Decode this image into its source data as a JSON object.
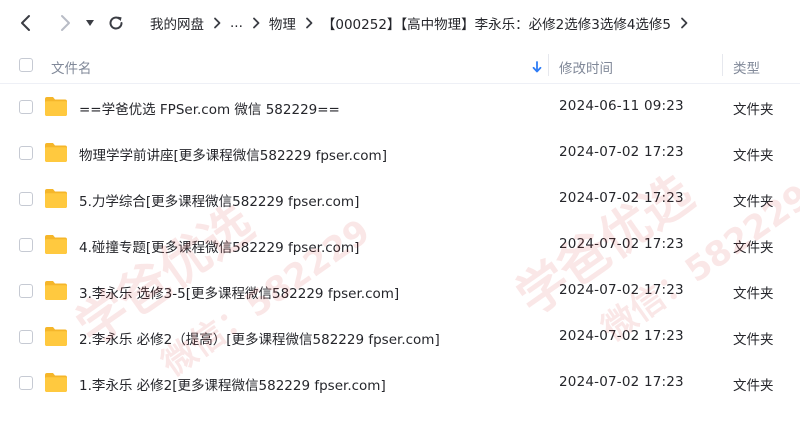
{
  "breadcrumb": {
    "items": [
      "我的网盘",
      "...",
      "物理",
      "【000252】【高中物理】李永乐：必修2选修3选修4选修5"
    ]
  },
  "header": {
    "name_label": "文件名",
    "time_label": "修改时间",
    "type_label": "类型"
  },
  "files": [
    {
      "name": "==学爸优选 FPSer.com 微信 582229==",
      "modified": "2024-06-11 09:23",
      "type": "文件夹"
    },
    {
      "name": "物理学学前讲座[更多课程微信582229 fpser.com]",
      "modified": "2024-07-02 17:23",
      "type": "文件夹"
    },
    {
      "name": "5.力学综合[更多课程微信582229 fpser.com]",
      "modified": "2024-07-02 17:23",
      "type": "文件夹"
    },
    {
      "name": "4.碰撞专题[更多课程微信582229 fpser.com]",
      "modified": "2024-07-02 17:23",
      "type": "文件夹"
    },
    {
      "name": "3.李永乐 选修3-5[更多课程微信582229 fpser.com]",
      "modified": "2024-07-02 17:23",
      "type": "文件夹"
    },
    {
      "name": "2.李永乐 必修2（提高）[更多课程微信582229 fpser.com]",
      "modified": "2024-07-02 17:23",
      "type": "文件夹"
    },
    {
      "name": "1.李永乐  必修2[更多课程微信582229 fpser.com]",
      "modified": "2024-07-02 17:23",
      "type": "文件夹"
    }
  ],
  "watermark": {
    "line1": "学爸优选",
    "line2": "微信：582229"
  },
  "colors": {
    "folder": "#ffc93f",
    "folder_tab": "#f5b62a",
    "accent": "#2e7cf6",
    "muted_text": "#818999"
  },
  "icons": {
    "back": "chevron-left-icon",
    "forward": "chevron-right-icon",
    "history": "caret-down-icon",
    "refresh": "refresh-icon",
    "sort": "arrow-down-icon",
    "folder": "folder-icon"
  }
}
